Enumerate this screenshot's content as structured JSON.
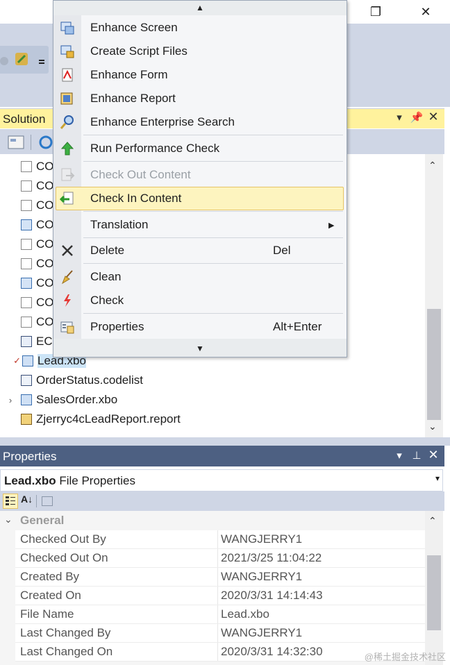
{
  "window": {
    "restore_glyph": "❐",
    "close_glyph": "✕"
  },
  "solution": {
    "title": "Solution",
    "items": [
      {
        "label": "CO",
        "icon": "blank-file-icon"
      },
      {
        "label": "CO",
        "icon": "blank-file-icon"
      },
      {
        "label": "CO",
        "icon": "blank-file-icon"
      },
      {
        "label": "CO",
        "icon": "screen-file-icon"
      },
      {
        "label": "CO",
        "icon": "blank-file-icon"
      },
      {
        "label": "CO",
        "icon": "blank-file-icon"
      },
      {
        "label": "CO",
        "icon": "screen-file-icon"
      },
      {
        "label": "CO",
        "icon": "blank-file-icon"
      },
      {
        "label": "CO",
        "icon": "blank-file-icon"
      },
      {
        "label": "ECI",
        "icon": "form-file-icon"
      },
      {
        "label": "Lead.xbo",
        "icon": "bo-file-icon"
      },
      {
        "label": "OrderStatus.codelist",
        "icon": "codelist-file-icon"
      },
      {
        "label": "SalesOrder.xbo",
        "icon": "bo-file-icon"
      },
      {
        "label": "Zjerryc4cLeadReport.report",
        "icon": "report-file-icon"
      }
    ]
  },
  "properties": {
    "title": "Properties",
    "object_name": "Lead.xbo",
    "object_suffix": " File Properties",
    "category": "General",
    "rows": [
      {
        "name": "Checked Out By",
        "value": "WANGJERRY1"
      },
      {
        "name": "Checked Out On",
        "value": "2021/3/25 11:04:22"
      },
      {
        "name": "Created By",
        "value": "WANGJERRY1"
      },
      {
        "name": "Created On",
        "value": "2020/3/31 14:14:43"
      },
      {
        "name": "File Name",
        "value": "Lead.xbo"
      },
      {
        "name": "Last Changed By",
        "value": "WANGJERRY1"
      },
      {
        "name": "Last Changed On",
        "value": "2020/3/31 14:32:30"
      }
    ]
  },
  "context_menu": {
    "items": [
      {
        "label": "Enhance Screen",
        "icon": "enhance-screen-icon"
      },
      {
        "label": "Create Script Files",
        "icon": "script-files-icon"
      },
      {
        "label": "Enhance Form",
        "icon": "enhance-form-icon"
      },
      {
        "label": "Enhance Report",
        "icon": "enhance-report-icon"
      },
      {
        "label": "Enhance Enterprise Search",
        "icon": "enterprise-search-icon"
      },
      {
        "label": "Run Performance Check",
        "icon": "performance-check-icon"
      },
      {
        "label": "Check Out Content",
        "icon": "check-out-icon",
        "disabled": true
      },
      {
        "label": "Check In Content",
        "icon": "check-in-icon",
        "highlighted": true
      },
      {
        "label": "Translation",
        "icon": "",
        "submenu": true
      },
      {
        "label": "Delete",
        "icon": "delete-icon",
        "shortcut": "Del"
      },
      {
        "label": "Clean",
        "icon": "clean-icon"
      },
      {
        "label": "Check",
        "icon": "check-icon"
      },
      {
        "label": "Properties",
        "icon": "properties-icon",
        "shortcut": "Alt+Enter"
      }
    ]
  },
  "watermark": "@稀土掘金技术社区",
  "colors": {
    "highlight": "#fdf4bf",
    "header_active": "#fff29d",
    "header_inactive": "#4d6082"
  }
}
